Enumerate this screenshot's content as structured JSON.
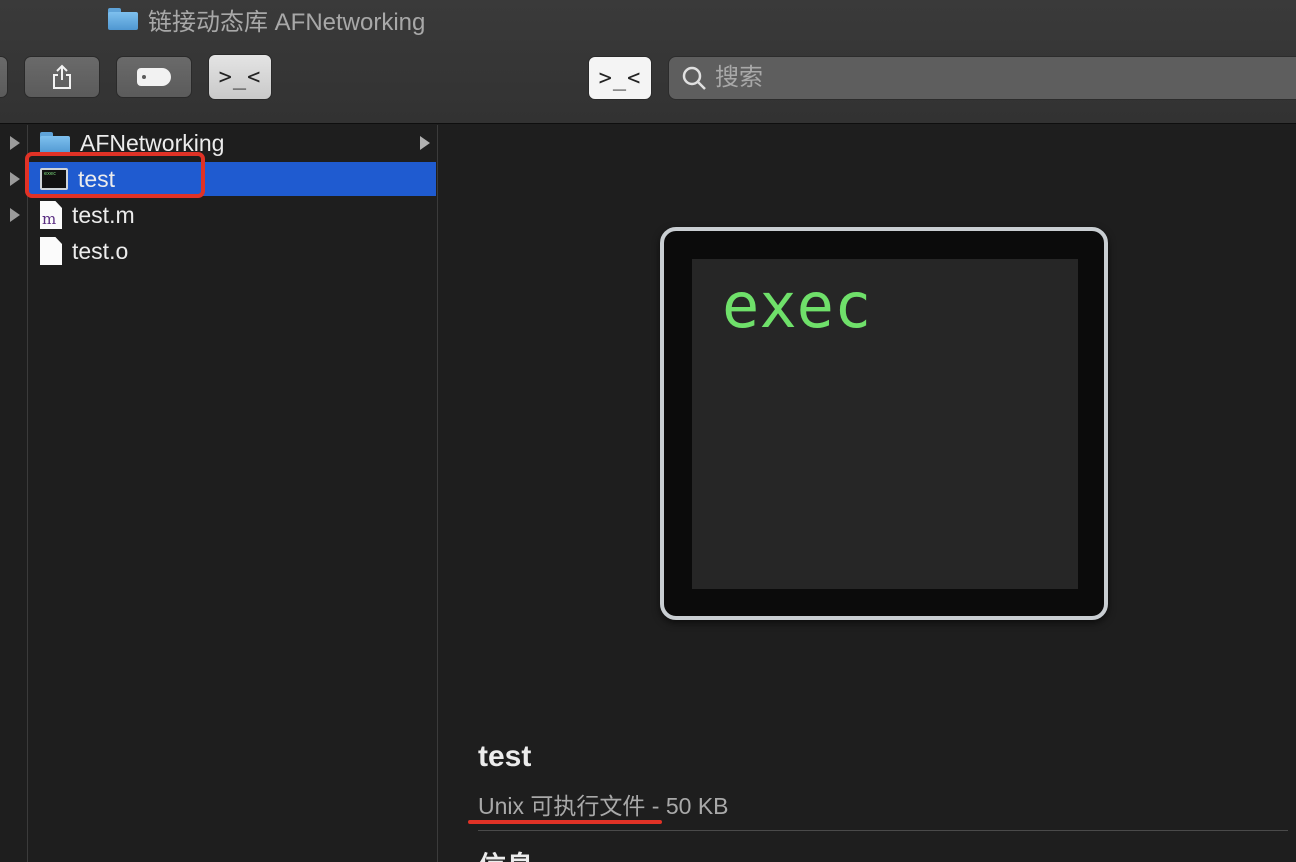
{
  "window": {
    "title": "链接动态库 AFNetworking"
  },
  "toolbar": {
    "share_icon": "share-icon",
    "tag_icon": "tag-icon",
    "terminal_icon": "terminal-icon",
    "terminal_glyph": ">_<",
    "search_placeholder": "搜索"
  },
  "column": {
    "items": [
      {
        "name": "AFNetworking",
        "icon": "folder-icon",
        "has_children": true,
        "selected": false
      },
      {
        "name": "test",
        "icon": "unix-executable-icon",
        "selected": true
      },
      {
        "name": "test.m",
        "icon": "objc-source-file-icon",
        "icon_letter": "m",
        "selected": false
      },
      {
        "name": "test.o",
        "icon": "object-file-icon",
        "selected": false
      }
    ]
  },
  "preview": {
    "icon_text": "exec",
    "name": "test",
    "kind": "Unix 可执行文件 - 50 KB",
    "section_title": "信息"
  },
  "annotations": {
    "highlight_color": "#e03226"
  },
  "colors": {
    "selection": "#1f5bd0",
    "exec_green": "#6fe06a"
  }
}
